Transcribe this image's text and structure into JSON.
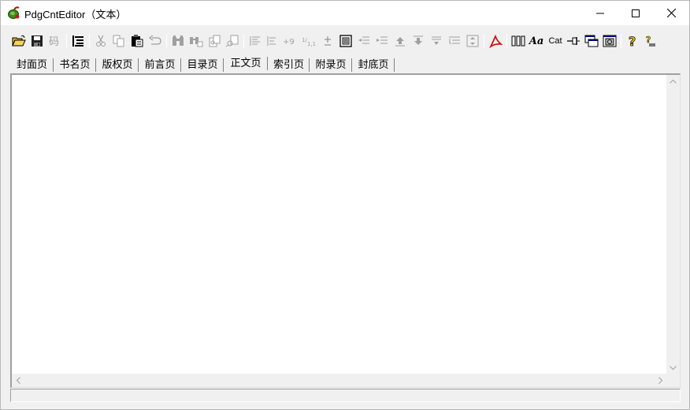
{
  "window": {
    "title": "PdgCntEditor（文本）",
    "controls": [
      "minimize",
      "maximize",
      "close"
    ]
  },
  "toolbar": {
    "groups": [
      [
        "open-icon",
        "save-icon",
        "code-icon"
      ],
      [
        "tree-icon"
      ],
      [
        "cut-icon",
        "copy-icon",
        "paste-icon",
        "undo-icon"
      ],
      [
        "find-icon",
        "replace-icon",
        "find-next-icon",
        "find-prev-icon"
      ],
      [
        "align-left-icon",
        "align-indent-icon",
        "insert-num-icon",
        "renumber-icon",
        "plus-minus-icon",
        "page-icon",
        "outdent-icon",
        "indent-icon",
        "move-up-icon",
        "move-down-icon",
        "level-up-icon",
        "level-down-icon",
        "expand-icon"
      ],
      [
        "pdf-icon"
      ],
      [
        "columns-icon",
        "font-icon",
        "cat-icon",
        "pin-icon",
        "window-icon",
        "preview-icon"
      ],
      [
        "help-icon",
        "context-help-icon"
      ]
    ],
    "cat_text": "Cat",
    "font_text": "Aa"
  },
  "tabs": [
    {
      "label": "封面页",
      "active": false
    },
    {
      "label": "书名页",
      "active": false
    },
    {
      "label": "版权页",
      "active": false
    },
    {
      "label": "前言页",
      "active": false
    },
    {
      "label": "目录页",
      "active": false
    },
    {
      "label": "正文页",
      "active": true
    },
    {
      "label": "索引页",
      "active": false
    },
    {
      "label": "附录页",
      "active": false
    },
    {
      "label": "封底页",
      "active": false
    }
  ],
  "editor": {
    "text": ""
  },
  "status": {
    "text": ""
  },
  "colors": {
    "titlebar": "#ffffff",
    "chrome": "#f0f0f0",
    "pdf_red": "#d40000",
    "help_yellow": "#f5d000"
  }
}
